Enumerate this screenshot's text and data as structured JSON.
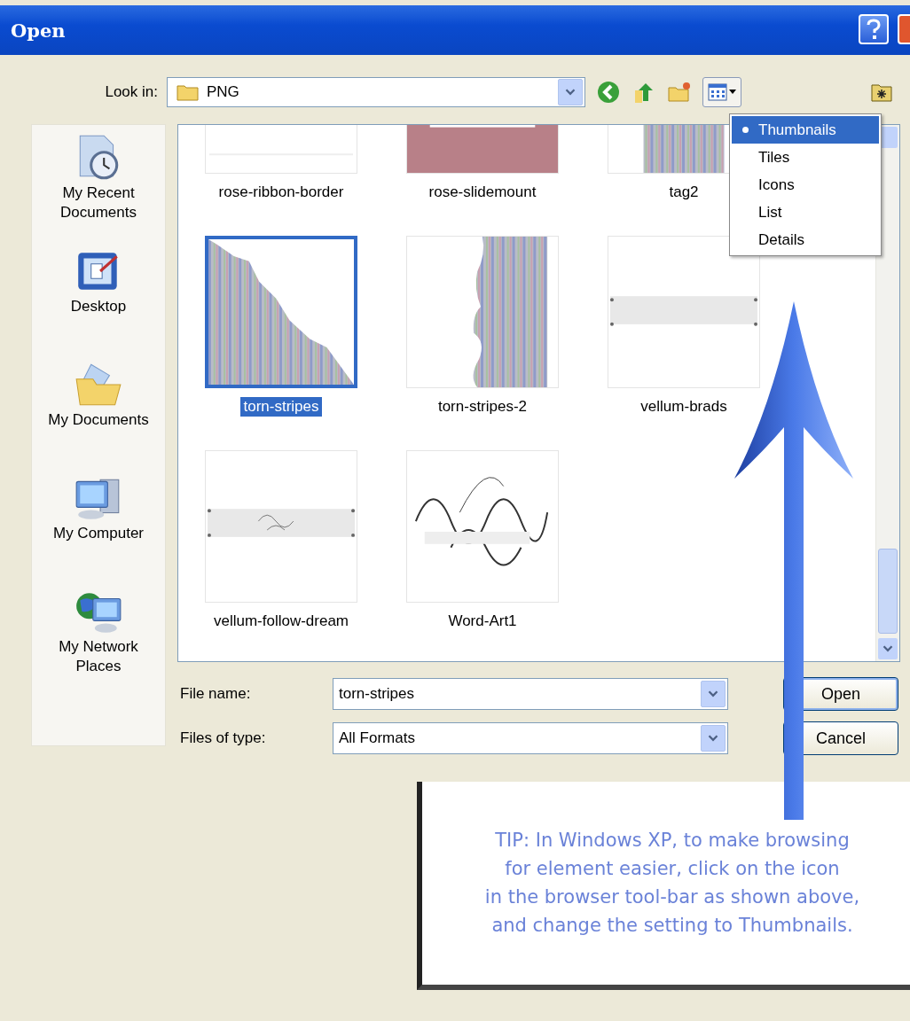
{
  "window": {
    "title": "Open"
  },
  "look_in": {
    "label": "Look in:",
    "value": "PNG"
  },
  "view_menu": [
    {
      "label": "Thumbnails",
      "selected": true
    },
    {
      "label": "Tiles",
      "selected": false
    },
    {
      "label": "Icons",
      "selected": false
    },
    {
      "label": "List",
      "selected": false
    },
    {
      "label": "Details",
      "selected": false
    }
  ],
  "places": [
    {
      "kind": "recent",
      "label": "My Recent Documents"
    },
    {
      "kind": "desktop",
      "label": "Desktop"
    },
    {
      "kind": "documents",
      "label": "My Documents"
    },
    {
      "kind": "computer",
      "label": "My Computer"
    },
    {
      "kind": "network",
      "label": "My Network Places"
    }
  ],
  "files": [
    {
      "name": "rose-ribbon-border",
      "selected": false
    },
    {
      "name": "rose-slidemount",
      "selected": false
    },
    {
      "name": "tag2",
      "selected": false
    },
    {
      "name": "torn-stripes",
      "selected": true
    },
    {
      "name": "torn-stripes-2",
      "selected": false
    },
    {
      "name": "vellum-brads",
      "selected": false
    },
    {
      "name": "vellum-follow-dream",
      "selected": false
    },
    {
      "name": "Word-Art1",
      "selected": false
    }
  ],
  "file_name": {
    "label": "File name:",
    "value": "torn-stripes"
  },
  "file_type": {
    "label": "Files of type:",
    "value": "All Formats"
  },
  "buttons": [
    "Open",
    "Cancel"
  ],
  "tip": "TIP:  In Windows XP, to make browsing\nfor element easier, click on the icon\nin the browser tool-bar as shown above,\nand change the setting to Thumbnails."
}
